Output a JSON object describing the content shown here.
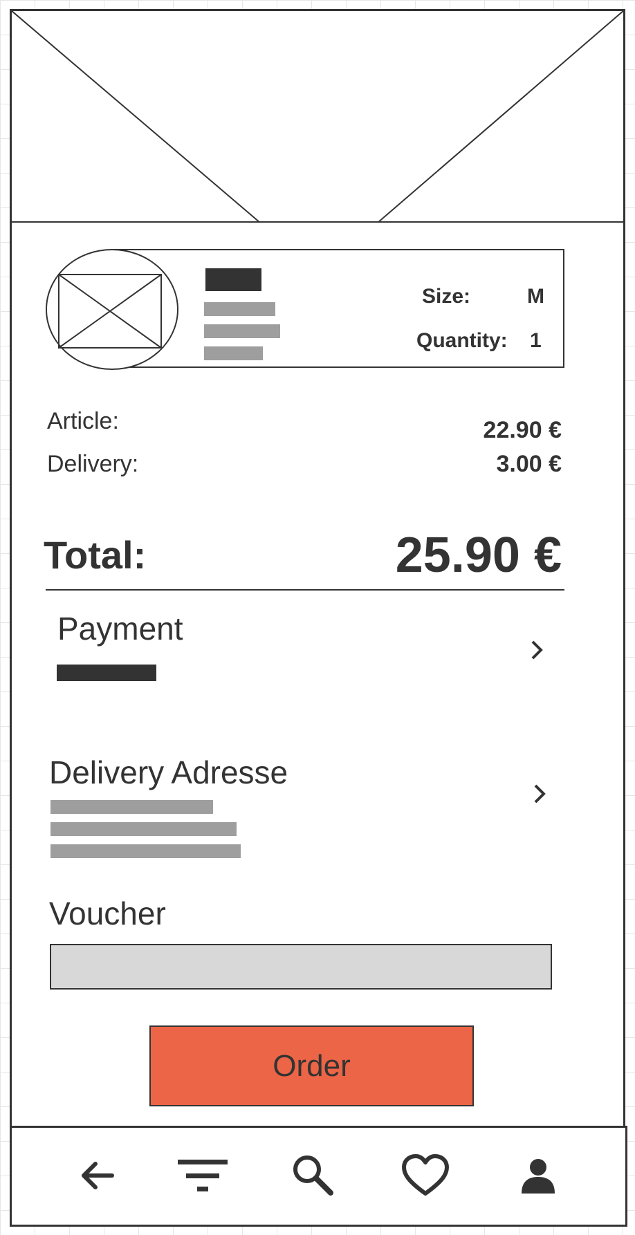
{
  "product": {
    "size_label": "Size:",
    "size_value": "M",
    "quantity_label": "Quantity:",
    "quantity_value": "1"
  },
  "summary": {
    "article_label": "Article:",
    "article_value": "22.90 €",
    "delivery_label": "Delivery:",
    "delivery_value": "3.00 €",
    "total_label": "Total:",
    "total_value": "25.90 €"
  },
  "payment": {
    "label": "Payment"
  },
  "delivery_address": {
    "label": "Delivery Adresse"
  },
  "voucher": {
    "label": "Voucher",
    "value": ""
  },
  "order_button": {
    "label": "Order"
  },
  "colors": {
    "accent": "#ec6546",
    "ink": "#333333",
    "placeholder": "#9e9e9e",
    "field": "#d8d8d8"
  },
  "nav": [
    {
      "icon": "back-arrow-icon"
    },
    {
      "icon": "filter-icon"
    },
    {
      "icon": "search-icon"
    },
    {
      "icon": "heart-icon"
    },
    {
      "icon": "person-icon"
    }
  ]
}
